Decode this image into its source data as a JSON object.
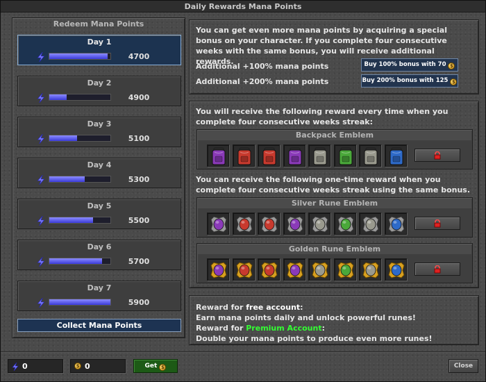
{
  "window": {
    "title": "Daily Rewards Mana Points"
  },
  "left": {
    "title": "Redeem Mana Points",
    "days": [
      {
        "label": "Day 1",
        "value": "4700",
        "progress": 0.95,
        "active": true
      },
      {
        "label": "Day 2",
        "value": "4900",
        "progress": 0.28,
        "active": false
      },
      {
        "label": "Day 3",
        "value": "5100",
        "progress": 0.45,
        "active": false
      },
      {
        "label": "Day 4",
        "value": "5300",
        "progress": 0.58,
        "active": false
      },
      {
        "label": "Day 5",
        "value": "5500",
        "progress": 0.72,
        "active": false
      },
      {
        "label": "Day 6",
        "value": "5700",
        "progress": 0.86,
        "active": false
      },
      {
        "label": "Day 7",
        "value": "5900",
        "progress": 1.0,
        "active": false
      }
    ],
    "collect_label": "Collect Mana Points"
  },
  "bonus": {
    "intro": "You can get even more mana points by acquiring a special bonus on your character. If you complete four consecutive weeks with the same bonus, you will receive additional rewards.",
    "row1_label": "Additional +100% mana points",
    "row1_button": "Buy 100% bonus with 70",
    "row2_label": "Additional +200% mana points",
    "row2_button": "Buy 200% bonus with 125"
  },
  "streak": {
    "intro1": "You will receive the following reward every time when you complete four consecutive weeks streak:",
    "backpack_title": "Backpack Emblem",
    "intro2": "You can receive the following one-time reward when you complete four consecutive weeks streak using the same bonus.",
    "silver_title": "Silver Rune Emblem",
    "golden_title": "Golden Rune Emblem",
    "backpack_items": [
      "purple-backpack",
      "red-backpack",
      "red-backpack",
      "purple-backpack",
      "grey-backpack",
      "green-backpack",
      "grey-backpack",
      "blue-backpack"
    ],
    "silver_items": [
      "purple-rune",
      "red-rune",
      "red-rune",
      "purple-rune",
      "grey-rune",
      "green-rune",
      "grey-rune",
      "blue-rune"
    ],
    "golden_items": [
      "purple-rune",
      "red-rune",
      "red-rune",
      "purple-rune",
      "grey-rune",
      "green-rune",
      "grey-rune",
      "blue-rune"
    ],
    "item_colors": {
      "purple": "#8a3ab8",
      "red": "#c83a2e",
      "grey": "#9a9a8e",
      "green": "#4aa83a",
      "blue": "#2e6ac8"
    }
  },
  "info": {
    "line1_prefix": "Reward for ",
    "line1_highlight": "free account",
    "line1_suffix": ":",
    "line2": "Earn mana points daily and unlock powerful runes!",
    "line3_prefix": "Reward for ",
    "line3_highlight": "Premium Account",
    "line3_suffix": ":",
    "line4": "Double your mana points to produce even more runes!"
  },
  "footer": {
    "mana_value": "0",
    "coin_value": "0",
    "get_label": "Get",
    "close_label": "Close"
  },
  "icons": {
    "mana": "lightning-icon",
    "coin": "coin-icon",
    "lock": "lock-icon"
  },
  "colors": {
    "active_day": "#1c3350",
    "premium_green": "#33ff33",
    "mana_bar": "#5a5aff"
  }
}
